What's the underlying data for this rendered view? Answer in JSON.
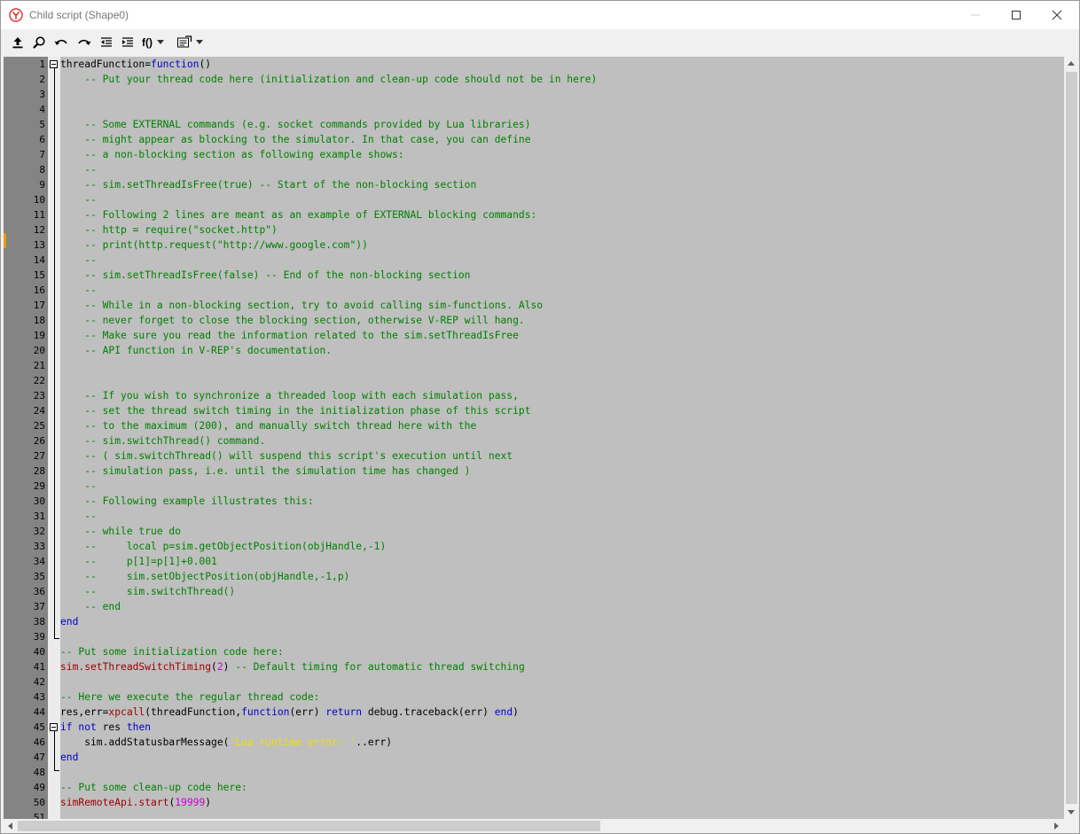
{
  "window": {
    "title": "Child script (Shape0)",
    "accent_color": "#e03030"
  },
  "toolbar": {
    "items": [
      {
        "name": "upload-icon"
      },
      {
        "name": "search-icon"
      },
      {
        "name": "undo-icon"
      },
      {
        "name": "redo-icon"
      },
      {
        "name": "outdent-icon"
      },
      {
        "name": "indent-icon"
      },
      {
        "name": "function-list-button",
        "label": "f()"
      },
      {
        "name": "snippets-button"
      }
    ]
  },
  "colors": {
    "comment": "#008000",
    "keyword": "#0000cc",
    "function": "#990000",
    "number": "#cc00cc",
    "string": "#f0e000",
    "plain": "#000000",
    "editor_bg": "#bfbfbf",
    "gutter_bg": "#848484"
  },
  "editor": {
    "lines": [
      {
        "n": "1",
        "tokens": [
          {
            "t": "threadFunction=",
            "c": "plain"
          },
          {
            "t": "function",
            "c": "keyword"
          },
          {
            "t": "()",
            "c": "plain"
          }
        ]
      },
      {
        "n": "2",
        "tokens": [
          {
            "t": "    -- Put your thread code here (initialization and clean-up code should not be in here)",
            "c": "comment"
          }
        ]
      },
      {
        "n": "3",
        "tokens": []
      },
      {
        "n": "4",
        "tokens": []
      },
      {
        "n": "5",
        "tokens": [
          {
            "t": "    -- Some EXTERNAL commands (e.g. socket commands provided by Lua libraries)",
            "c": "comment"
          }
        ]
      },
      {
        "n": "6",
        "tokens": [
          {
            "t": "    -- might appear as blocking to the simulator. In that case, you can define",
            "c": "comment"
          }
        ]
      },
      {
        "n": "7",
        "tokens": [
          {
            "t": "    -- a non-blocking section as following example shows:",
            "c": "comment"
          }
        ]
      },
      {
        "n": "8",
        "tokens": [
          {
            "t": "    --",
            "c": "comment"
          }
        ]
      },
      {
        "n": "9",
        "tokens": [
          {
            "t": "    -- sim.setThreadIsFree(true) -- Start of the non-blocking section",
            "c": "comment"
          }
        ]
      },
      {
        "n": "10",
        "tokens": [
          {
            "t": "    --",
            "c": "comment"
          }
        ]
      },
      {
        "n": "11",
        "tokens": [
          {
            "t": "    -- Following 2 lines are meant as an example of EXTERNAL blocking commands:",
            "c": "comment"
          }
        ]
      },
      {
        "n": "12",
        "tokens": [
          {
            "t": "    -- http = require(\"socket.http\")",
            "c": "comment"
          }
        ]
      },
      {
        "n": "13",
        "tokens": [
          {
            "t": "    -- print(http.request(\"http://www.google.com\"))",
            "c": "comment"
          }
        ]
      },
      {
        "n": "14",
        "tokens": [
          {
            "t": "    --",
            "c": "comment"
          }
        ]
      },
      {
        "n": "15",
        "tokens": [
          {
            "t": "    -- sim.setThreadIsFree(false) -- End of the non-blocking section",
            "c": "comment"
          }
        ]
      },
      {
        "n": "16",
        "tokens": [
          {
            "t": "    --",
            "c": "comment"
          }
        ]
      },
      {
        "n": "17",
        "tokens": [
          {
            "t": "    -- While in a non-blocking section, try to avoid calling sim-functions. Also",
            "c": "comment"
          }
        ]
      },
      {
        "n": "18",
        "tokens": [
          {
            "t": "    -- never forget to close the blocking section, otherwise V-REP will hang.",
            "c": "comment"
          }
        ]
      },
      {
        "n": "19",
        "tokens": [
          {
            "t": "    -- Make sure you read the information related to the sim.setThreadIsFree",
            "c": "comment"
          }
        ]
      },
      {
        "n": "20",
        "tokens": [
          {
            "t": "    -- API function in V-REP's documentation.",
            "c": "comment"
          }
        ]
      },
      {
        "n": "21",
        "tokens": []
      },
      {
        "n": "22",
        "tokens": []
      },
      {
        "n": "23",
        "tokens": [
          {
            "t": "    -- If you wish to synchronize a threaded loop with each simulation pass,",
            "c": "comment"
          }
        ]
      },
      {
        "n": "24",
        "tokens": [
          {
            "t": "    -- set the thread switch timing in the initialization phase of this script",
            "c": "comment"
          }
        ]
      },
      {
        "n": "25",
        "tokens": [
          {
            "t": "    -- to the maximum (200), and manually switch thread here with the",
            "c": "comment"
          }
        ]
      },
      {
        "n": "26",
        "tokens": [
          {
            "t": "    -- sim.switchThread() command.",
            "c": "comment"
          }
        ]
      },
      {
        "n": "27",
        "tokens": [
          {
            "t": "    -- ( sim.switchThread() will suspend this script's execution until next",
            "c": "comment"
          }
        ]
      },
      {
        "n": "28",
        "tokens": [
          {
            "t": "    -- simulation pass, i.e. until the simulation time has changed )",
            "c": "comment"
          }
        ]
      },
      {
        "n": "29",
        "tokens": [
          {
            "t": "    --",
            "c": "comment"
          }
        ]
      },
      {
        "n": "30",
        "tokens": [
          {
            "t": "    -- Following example illustrates this:",
            "c": "comment"
          }
        ]
      },
      {
        "n": "31",
        "tokens": [
          {
            "t": "    --",
            "c": "comment"
          }
        ]
      },
      {
        "n": "32",
        "tokens": [
          {
            "t": "    -- while true do",
            "c": "comment"
          }
        ]
      },
      {
        "n": "33",
        "tokens": [
          {
            "t": "    --     local p=sim.getObjectPosition(objHandle,-1)",
            "c": "comment"
          }
        ]
      },
      {
        "n": "34",
        "tokens": [
          {
            "t": "    --     p[1]=p[1]+0.001",
            "c": "comment"
          }
        ]
      },
      {
        "n": "35",
        "tokens": [
          {
            "t": "    --     sim.setObjectPosition(objHandle,-1,p)",
            "c": "comment"
          }
        ]
      },
      {
        "n": "36",
        "tokens": [
          {
            "t": "    --     sim.switchThread()",
            "c": "comment"
          }
        ]
      },
      {
        "n": "37",
        "tokens": [
          {
            "t": "    -- end",
            "c": "comment"
          }
        ]
      },
      {
        "n": "38",
        "tokens": [
          {
            "t": "end",
            "c": "keyword"
          }
        ]
      },
      {
        "n": "39",
        "tokens": []
      },
      {
        "n": "40",
        "tokens": [
          {
            "t": "-- Put some initialization code here:",
            "c": "comment"
          }
        ]
      },
      {
        "n": "41",
        "tokens": [
          {
            "t": "sim.setThreadSwitchTiming",
            "c": "function"
          },
          {
            "t": "(",
            "c": "plain"
          },
          {
            "t": "2",
            "c": "number"
          },
          {
            "t": ") ",
            "c": "plain"
          },
          {
            "t": "-- Default timing for automatic thread switching",
            "c": "comment"
          }
        ]
      },
      {
        "n": "42",
        "tokens": []
      },
      {
        "n": "43",
        "tokens": [
          {
            "t": "-- Here we execute the regular thread code:",
            "c": "comment"
          }
        ]
      },
      {
        "n": "44",
        "tokens": [
          {
            "t": "res,err=",
            "c": "plain"
          },
          {
            "t": "xpcall",
            "c": "function"
          },
          {
            "t": "(threadFunction,",
            "c": "plain"
          },
          {
            "t": "function",
            "c": "keyword"
          },
          {
            "t": "(err) ",
            "c": "plain"
          },
          {
            "t": "return",
            "c": "keyword"
          },
          {
            "t": " debug.traceback(err) ",
            "c": "plain"
          },
          {
            "t": "end",
            "c": "keyword"
          },
          {
            "t": ")",
            "c": "plain"
          }
        ]
      },
      {
        "n": "45",
        "tokens": [
          {
            "t": "if",
            "c": "keyword"
          },
          {
            "t": " ",
            "c": "plain"
          },
          {
            "t": "not",
            "c": "keyword"
          },
          {
            "t": " res ",
            "c": "plain"
          },
          {
            "t": "then",
            "c": "keyword"
          }
        ]
      },
      {
        "n": "46",
        "tokens": [
          {
            "t": "    sim.addStatusbarMessage(",
            "c": "plain"
          },
          {
            "t": "'Lua runtime error: '",
            "c": "string"
          },
          {
            "t": "..err)",
            "c": "plain"
          }
        ]
      },
      {
        "n": "47",
        "tokens": [
          {
            "t": "end",
            "c": "keyword"
          }
        ]
      },
      {
        "n": "48",
        "tokens": []
      },
      {
        "n": "49",
        "tokens": [
          {
            "t": "-- Put some clean-up code here:",
            "c": "comment"
          }
        ]
      },
      {
        "n": "50",
        "tokens": [
          {
            "t": "simRemoteApi.start",
            "c": "function"
          },
          {
            "t": "(",
            "c": "plain"
          },
          {
            "t": "19999",
            "c": "number"
          },
          {
            "t": ")",
            "c": "plain"
          }
        ]
      },
      {
        "n": "51",
        "tokens": []
      }
    ]
  }
}
